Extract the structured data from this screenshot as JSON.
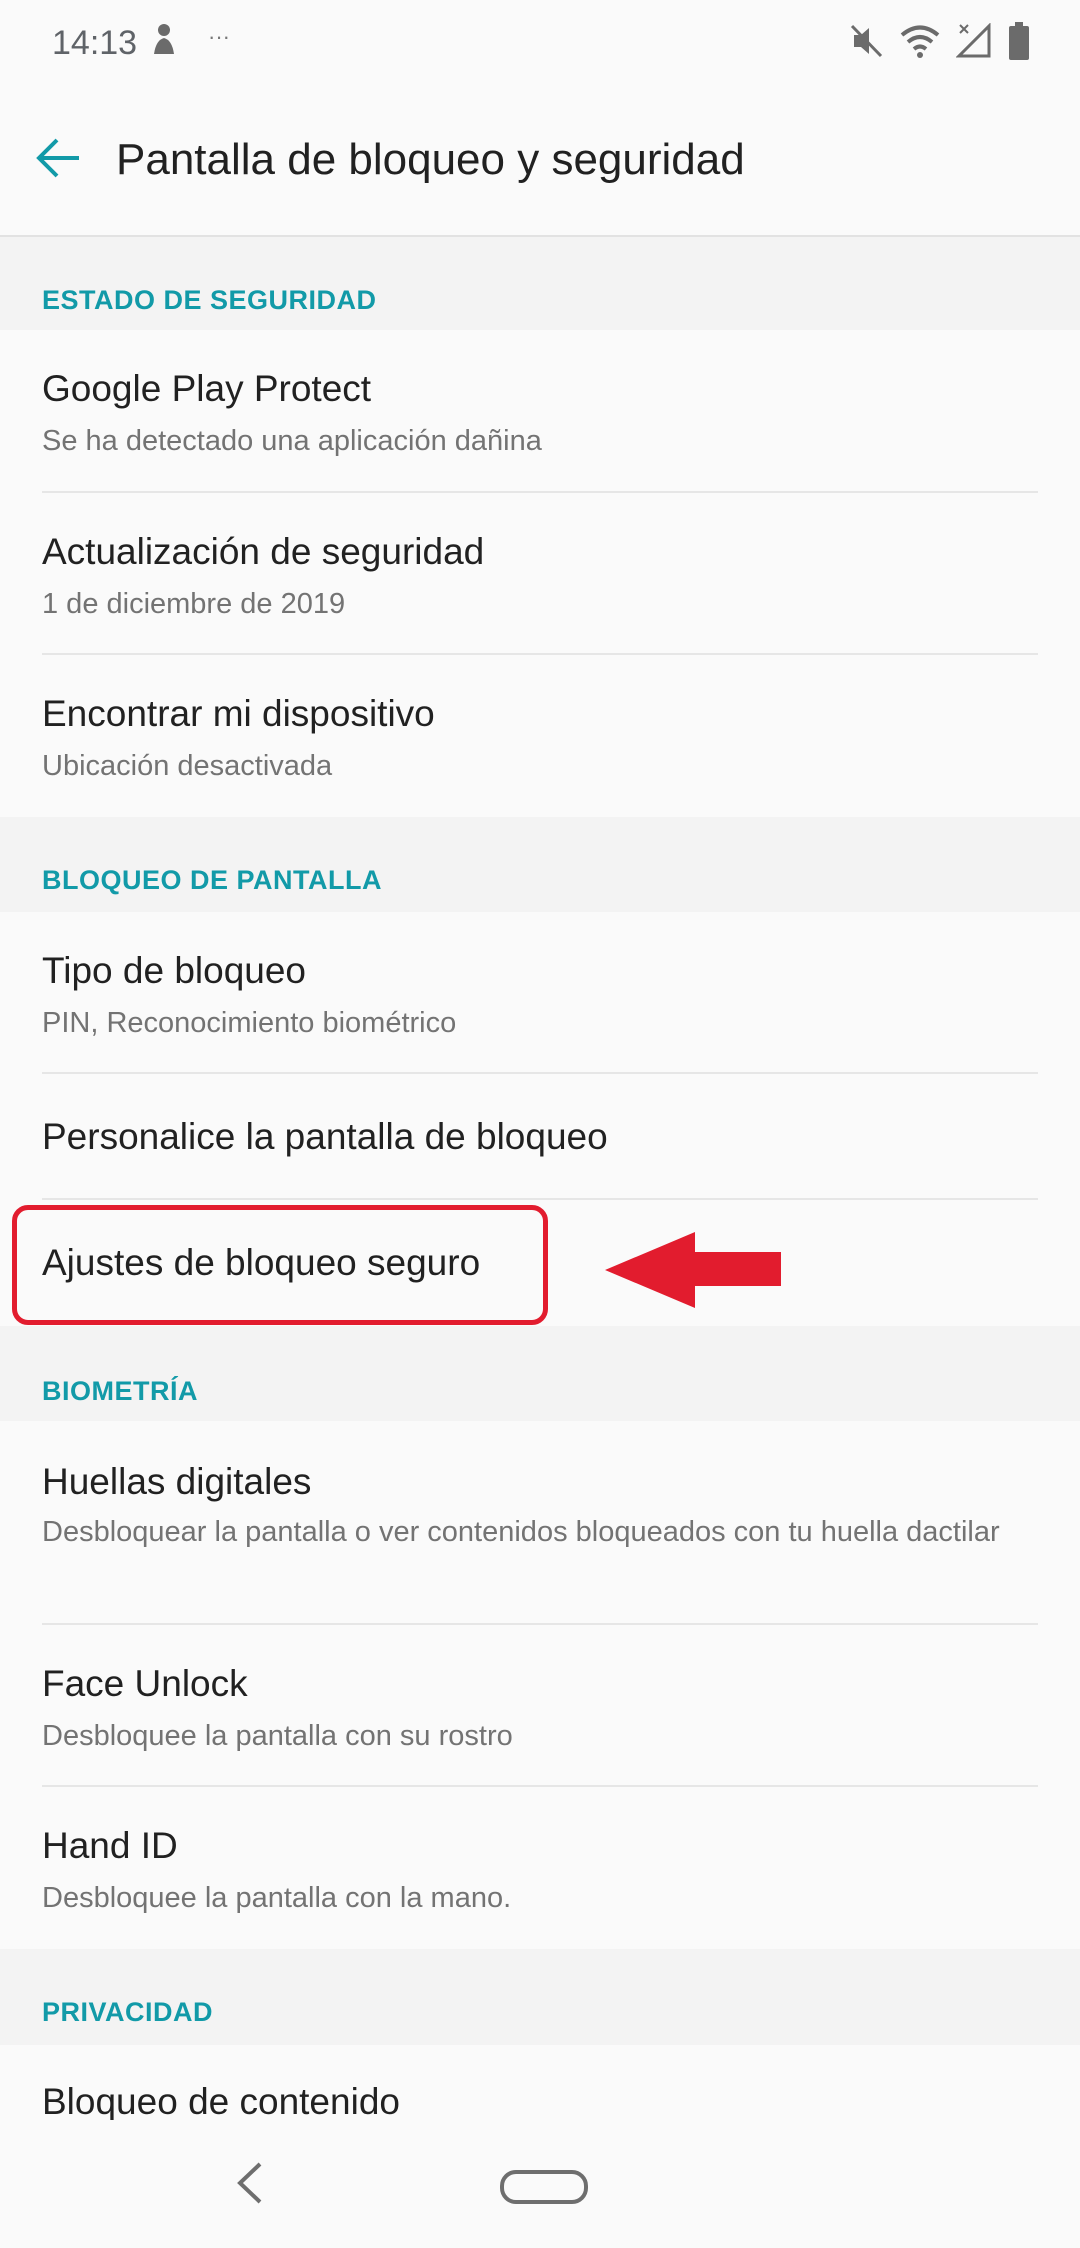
{
  "status_bar": {
    "time": "14:13",
    "extra_indicator": "···",
    "icons": [
      "notification-person-icon",
      "mute-icon",
      "wifi-icon",
      "no-signal-icon",
      "battery-icon"
    ]
  },
  "app_bar": {
    "title": "Pantalla de bloqueo y seguridad",
    "back_icon": "arrow-back-icon"
  },
  "sections": {
    "security_status": {
      "header": "ESTADO DE SEGURIDAD",
      "items": [
        {
          "title": "Google Play Protect",
          "subtitle": "Se ha detectado una aplicación dañina"
        },
        {
          "title": "Actualización de seguridad",
          "subtitle": "1 de diciembre de 2019"
        },
        {
          "title": "Encontrar mi dispositivo",
          "subtitle": "Ubicación desactivada"
        }
      ]
    },
    "screen_lock": {
      "header": "BLOQUEO DE PANTALLA",
      "items": [
        {
          "title": "Tipo de bloqueo",
          "subtitle": "PIN, Reconocimiento biométrico"
        },
        {
          "title": "Personalice la pantalla de bloqueo"
        },
        {
          "title": "Ajustes de bloqueo seguro"
        }
      ]
    },
    "biometrics": {
      "header": "BIOMETRÍA",
      "items": [
        {
          "title": "Huellas digitales",
          "subtitle": "Desbloquear la pantalla o ver contenidos bloqueados con tu huella dactilar"
        },
        {
          "title": "Face Unlock",
          "subtitle": "Desbloquee la pantalla con su rostro"
        },
        {
          "title": "Hand ID",
          "subtitle": "Desbloquee la pantalla con la mano."
        }
      ]
    },
    "privacy": {
      "header": "PRIVACIDAD",
      "items": [
        {
          "title": "Bloqueo de contenido"
        }
      ]
    }
  },
  "colors": {
    "accent": "#129aa8",
    "annotation_red": "#e21c2e",
    "section_background": "#f3f3f3",
    "background": "#fafafa"
  }
}
